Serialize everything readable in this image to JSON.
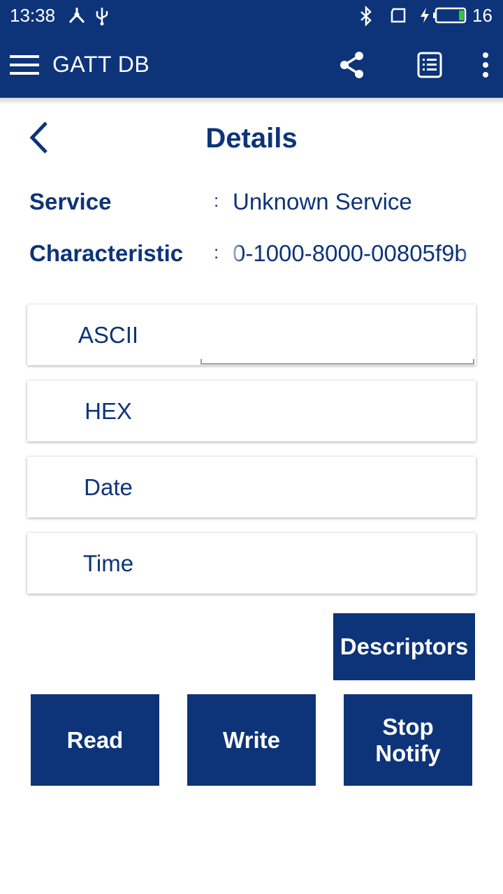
{
  "status_bar": {
    "time": "13:38",
    "battery_level": "16",
    "icons": [
      "network-icon",
      "usb-icon",
      "bluetooth-icon",
      "screen-rotate-icon",
      "charging-icon",
      "battery-icon"
    ]
  },
  "app_bar": {
    "title": "GATT DB",
    "icons": [
      "menu-icon",
      "share-icon",
      "log-list-icon",
      "more-vert-icon"
    ]
  },
  "details": {
    "title": "Details",
    "service_label": "Service",
    "service_value": "Unknown Service",
    "characteristic_label": "Characteristic",
    "characteristic_value": "0-1000-8000-00805f9b"
  },
  "fields": [
    {
      "label": "ASCII",
      "value": ""
    },
    {
      "label": "HEX",
      "value": ""
    },
    {
      "label": "Date",
      "value": ""
    },
    {
      "label": "Time",
      "value": ""
    }
  ],
  "buttons": {
    "descriptors": "Descriptors",
    "read": "Read",
    "write": "Write",
    "stop_notify_line1": "Stop",
    "stop_notify_line2": "Notify"
  },
  "colors": {
    "primary": "#0d3479",
    "background": "#ffffff",
    "battery_fill": "#35c63a"
  }
}
